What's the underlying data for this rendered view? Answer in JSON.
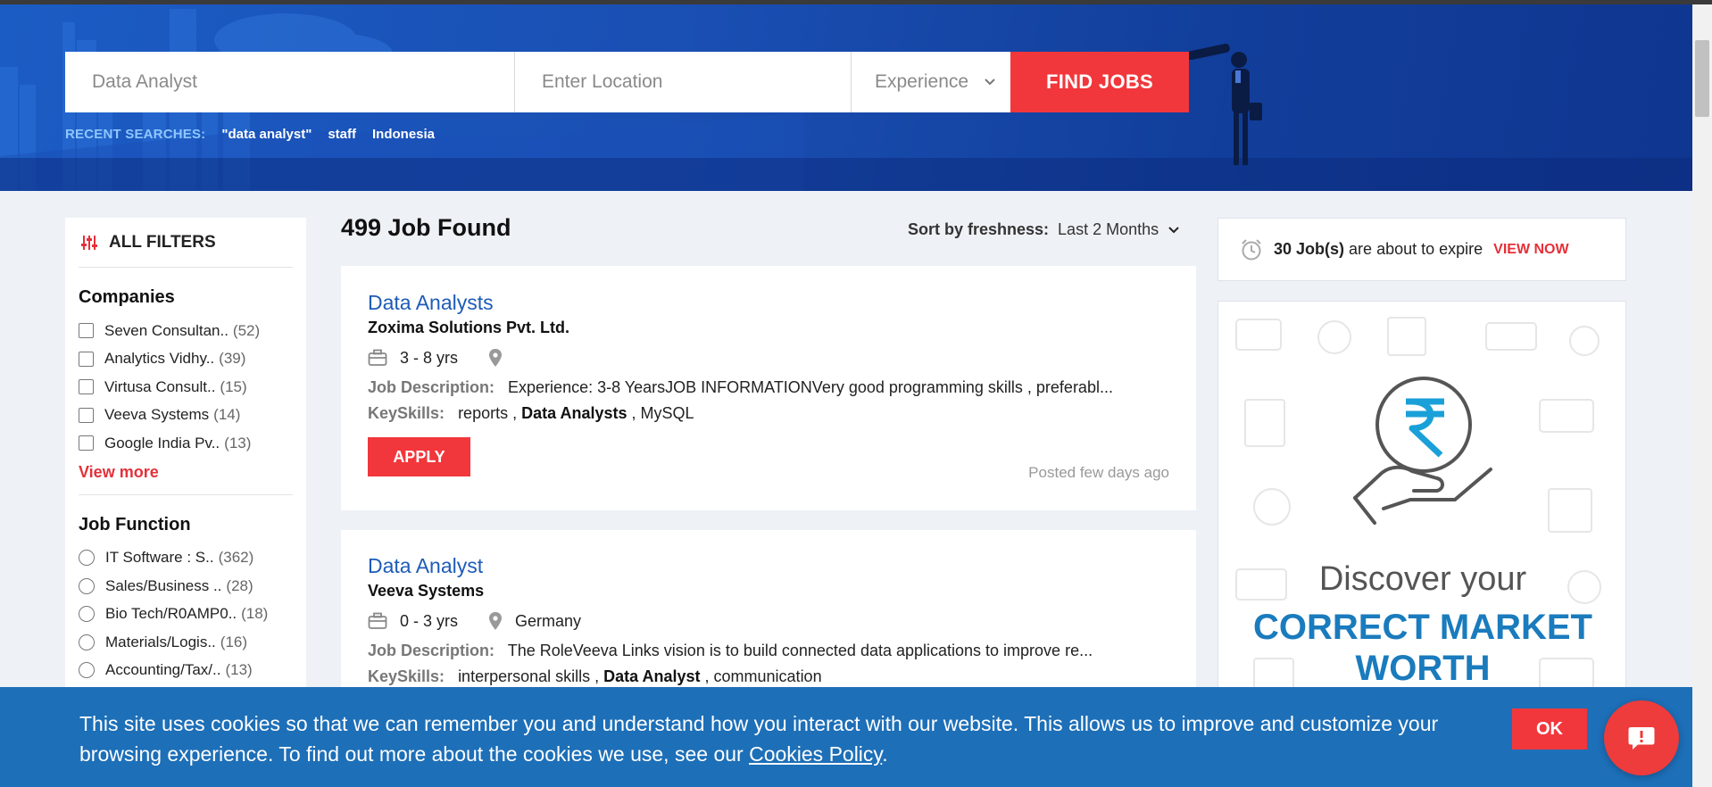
{
  "search": {
    "keyword_value": "Data Analyst",
    "location_placeholder": "Enter Location",
    "experience_label": "Experience",
    "find_label": "FIND JOBS"
  },
  "recent": {
    "label": "RECENT SEARCHES:",
    "items": [
      "\"data analyst\"",
      "staff",
      "Indonesia"
    ]
  },
  "filters": {
    "title": "ALL FILTERS",
    "companies": {
      "heading": "Companies",
      "items": [
        {
          "name": "Seven Consultan..",
          "count": "(52)"
        },
        {
          "name": "Analytics Vidhy..",
          "count": "(39)"
        },
        {
          "name": "Virtusa Consult..",
          "count": "(15)"
        },
        {
          "name": "Veeva Systems",
          "count": "(14)"
        },
        {
          "name": "Google India Pv..",
          "count": "(13)"
        }
      ],
      "view_more": "View more"
    },
    "job_function": {
      "heading": "Job Function",
      "items": [
        {
          "name": "IT Software : S..",
          "count": "(362)"
        },
        {
          "name": "Sales/Business ..",
          "count": "(28)"
        },
        {
          "name": "Bio Tech/R0AMP0..",
          "count": "(18)"
        },
        {
          "name": "Materials/Logis..",
          "count": "(16)"
        },
        {
          "name": "Accounting/Tax/..",
          "count": "(13)"
        }
      ]
    }
  },
  "results": {
    "title": "499 Job Found",
    "sort_label": "Sort by freshness:",
    "sort_value": "Last 2 Months"
  },
  "jobs": [
    {
      "title": "Data Analysts",
      "company": "Zoxima Solutions Pvt. Ltd.",
      "experience": "3 - 8 yrs",
      "location": "",
      "desc_label": "Job Description:",
      "description": "Experience: 3-8 YearsJOB INFORMATIONVery good programming skills , preferabl...",
      "skills_label": "KeySkills:",
      "skills": [
        "reports",
        "Data Analysts",
        "MySQL"
      ],
      "apply_label": "APPLY",
      "posted": "Posted few days ago"
    },
    {
      "title": "Data Analyst",
      "company": "Veeva Systems",
      "experience": "0 - 3 yrs",
      "location": "Germany",
      "desc_label": "Job Description:",
      "description": "The RoleVeeva Links vision is to build connected data applications to improve re...",
      "skills_label": "KeySkills:",
      "skills": [
        "interpersonal skills",
        "Data Analyst",
        "communication"
      ]
    }
  ],
  "expire": {
    "count": "30 Job(s)",
    "text": "are about to expire",
    "link": "VIEW NOW"
  },
  "ad": {
    "line1": "Discover your",
    "line2": "CORRECT MARKET",
    "line3": "WORTH"
  },
  "cookie": {
    "message": "This site uses cookies so that we can remember you and understand how you interact with our website. This allows us to improve and customize your browsing experience. To find out more about the cookies we use, see our",
    "link": "Cookies Policy",
    "end": ".",
    "ok": "OK"
  },
  "colors": {
    "accent_red": "#f1373c",
    "brand_blue": "#1a4fb3",
    "link_blue": "#1d5cb8",
    "cookie_blue": "#1d6fb8"
  }
}
